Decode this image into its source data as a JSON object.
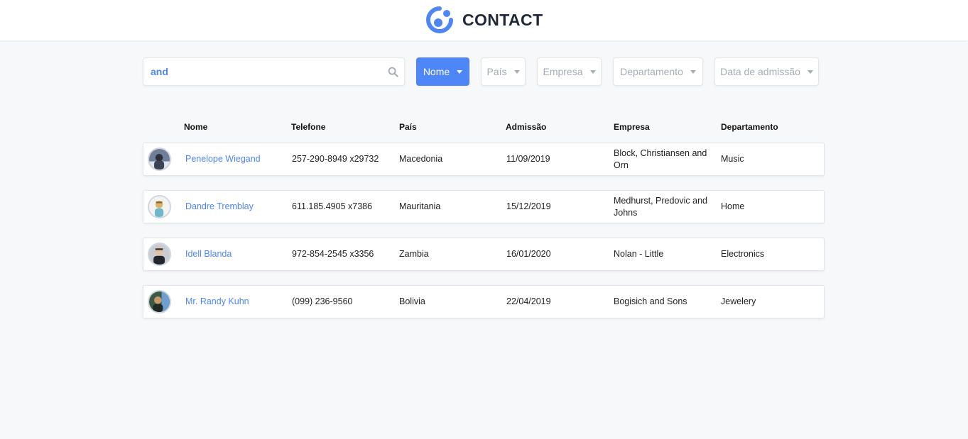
{
  "header": {
    "brand": "CONTACT"
  },
  "search": {
    "value": "and",
    "placeholder": ""
  },
  "filters": [
    {
      "label": "Nome",
      "active": true
    },
    {
      "label": "País",
      "active": false
    },
    {
      "label": "Empresa",
      "active": false
    },
    {
      "label": "Departamento",
      "active": false
    },
    {
      "label": "Data de admissão",
      "active": false
    }
  ],
  "table": {
    "columns": [
      "Nome",
      "Telefone",
      "País",
      "Admissão",
      "Empresa",
      "Departamento"
    ],
    "rows": [
      {
        "name": "Penelope Wiegand",
        "phone": "257-290-8949 x29732",
        "country": "Macedonia",
        "admission": "11/09/2019",
        "company": "Block, Christiansen and Orn",
        "department": "Music"
      },
      {
        "name": "Dandre Tremblay",
        "phone": "611.185.4905 x7386",
        "country": "Mauritania",
        "admission": "15/12/2019",
        "company": "Medhurst, Predovic and Johns",
        "department": "Home"
      },
      {
        "name": "Idell Blanda",
        "phone": "972-854-2545 x3356",
        "country": "Zambia",
        "admission": "16/01/2020",
        "company": "Nolan - Little",
        "department": "Electronics"
      },
      {
        "name": "Mr. Randy Kuhn",
        "phone": "(099) 236-9560",
        "country": "Bolivia",
        "admission": "22/04/2019",
        "company": "Bogisich and Sons",
        "department": "Jewelery"
      }
    ]
  },
  "colors": {
    "accent": "#4f86f7",
    "background": "#f7f8fa",
    "muted": "#a6acb5"
  }
}
